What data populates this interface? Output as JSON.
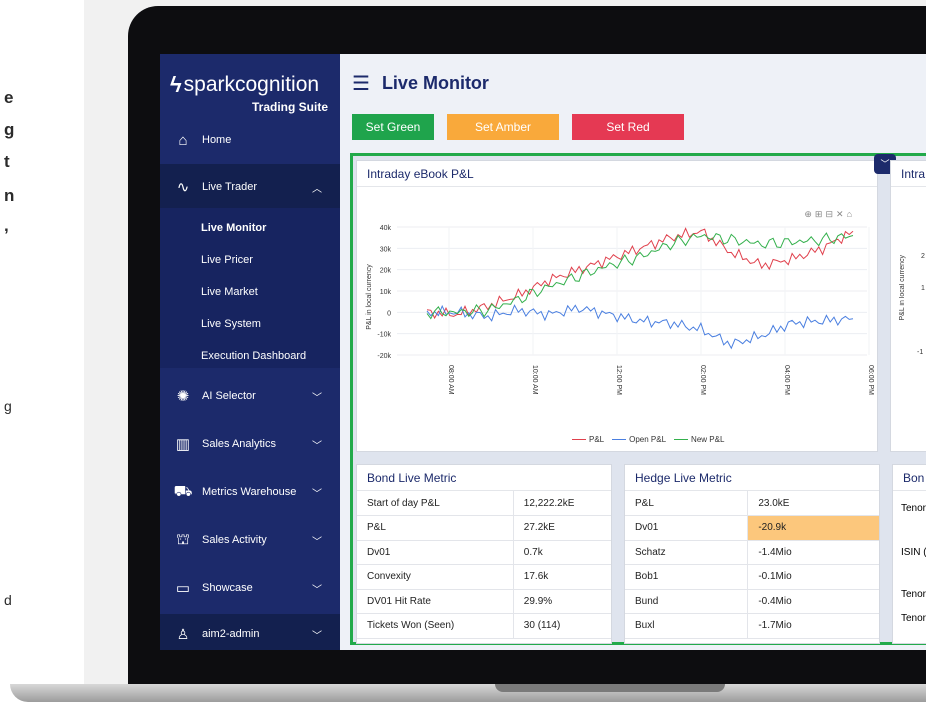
{
  "left_fragments": [
    "e",
    "g",
    "t",
    "n",
    ",",
    "g",
    "d"
  ],
  "brand": {
    "name": "sparkcognition",
    "sub": "Trading Suite"
  },
  "nav": [
    {
      "label": "Home",
      "icon": "home-icon"
    },
    {
      "label": "Live Trader",
      "icon": "pulse-icon"
    },
    {
      "label": "AI Selector",
      "icon": "brain-icon"
    },
    {
      "label": "Sales Analytics",
      "icon": "bar-chart-icon"
    },
    {
      "label": "Metrics Warehouse",
      "icon": "truck-icon"
    },
    {
      "label": "Sales Activity",
      "icon": "gift-icon"
    },
    {
      "label": "Showcase",
      "icon": "monitor-icon"
    }
  ],
  "subnav": [
    "Live Monitor",
    "Live Pricer",
    "Live Market",
    "Live System",
    "Execution Dashboard"
  ],
  "user": "aim2-admin",
  "page_title": "Live Monitor",
  "buttons": {
    "green": "Set Green",
    "amber": "Set Amber",
    "red": "Set Red"
  },
  "colors": {
    "green": "#1fa44c",
    "amber": "#f9a93b",
    "red": "#e53953",
    "sidebar": "#1c2a6b"
  },
  "chart_card": {
    "title": "Intraday eBook P&L"
  },
  "partial_card": {
    "title": "Intra"
  },
  "chart_data": {
    "type": "line",
    "title": "Intraday eBook P&L",
    "ylabel": "P&L in local currency",
    "x_ticks": [
      "08:00 AM",
      "10:00 AM",
      "12:00 PM",
      "02:00 PM",
      "04:00 PM",
      "06:00 PM"
    ],
    "y_ticks": [
      "40k",
      "30k",
      "20k",
      "10k",
      "0",
      "-10k",
      "-20k"
    ],
    "ylim": [
      -20000,
      40000
    ],
    "series": [
      {
        "name": "P&L",
        "color": "#e0404c",
        "values": [
          0,
          -1000,
          3000,
          8000,
          15000,
          20000,
          25000,
          30000,
          35000,
          38000,
          28000,
          22000,
          25000,
          30000,
          38000
        ]
      },
      {
        "name": "Open P&L",
        "color": "#4a7fe0",
        "values": [
          0,
          0,
          -2000,
          1000,
          -1000,
          2000,
          -1000,
          -4000,
          -5000,
          -8000,
          -15000,
          -11000,
          -5000,
          -4000,
          -3000
        ]
      },
      {
        "name": "New P&L",
        "color": "#33b04c",
        "values": [
          0,
          0,
          1000,
          6000,
          12000,
          17000,
          22000,
          26000,
          32000,
          36000,
          34000,
          32000,
          33000,
          34000,
          36000
        ]
      }
    ],
    "legend": "bottom",
    "grid": true
  },
  "right_axis_ticks": [
    "2",
    "1",
    "-1"
  ],
  "right_ylabel": "P&L in local currency",
  "bond": {
    "title": "Bond Live Metric",
    "rows": [
      [
        "Start of day P&L",
        "12,222.2kE"
      ],
      [
        "P&L",
        "27.2kE"
      ],
      [
        "Dv01",
        "0.7k"
      ],
      [
        "Convexity",
        "17.6k"
      ],
      [
        "DV01 Hit Rate",
        "29.9%"
      ],
      [
        "Tickets Won (Seen)",
        "30 (114)"
      ]
    ]
  },
  "hedge": {
    "title": "Hedge Live Metric",
    "rows": [
      [
        "P&L",
        "23.0kE"
      ],
      [
        "Dv01",
        "-20.9k"
      ],
      [
        "Schatz",
        "-1.4Mio"
      ],
      [
        "Bob1",
        "-0.1Mio"
      ],
      [
        "Bund",
        "-0.4Mio"
      ],
      [
        "Buxl",
        "-1.7Mio"
      ]
    ]
  },
  "bond_partial": {
    "title": "Bon",
    "rows": [
      "Tenor",
      "ISIN (",
      "Tenor",
      "Tenor"
    ]
  }
}
